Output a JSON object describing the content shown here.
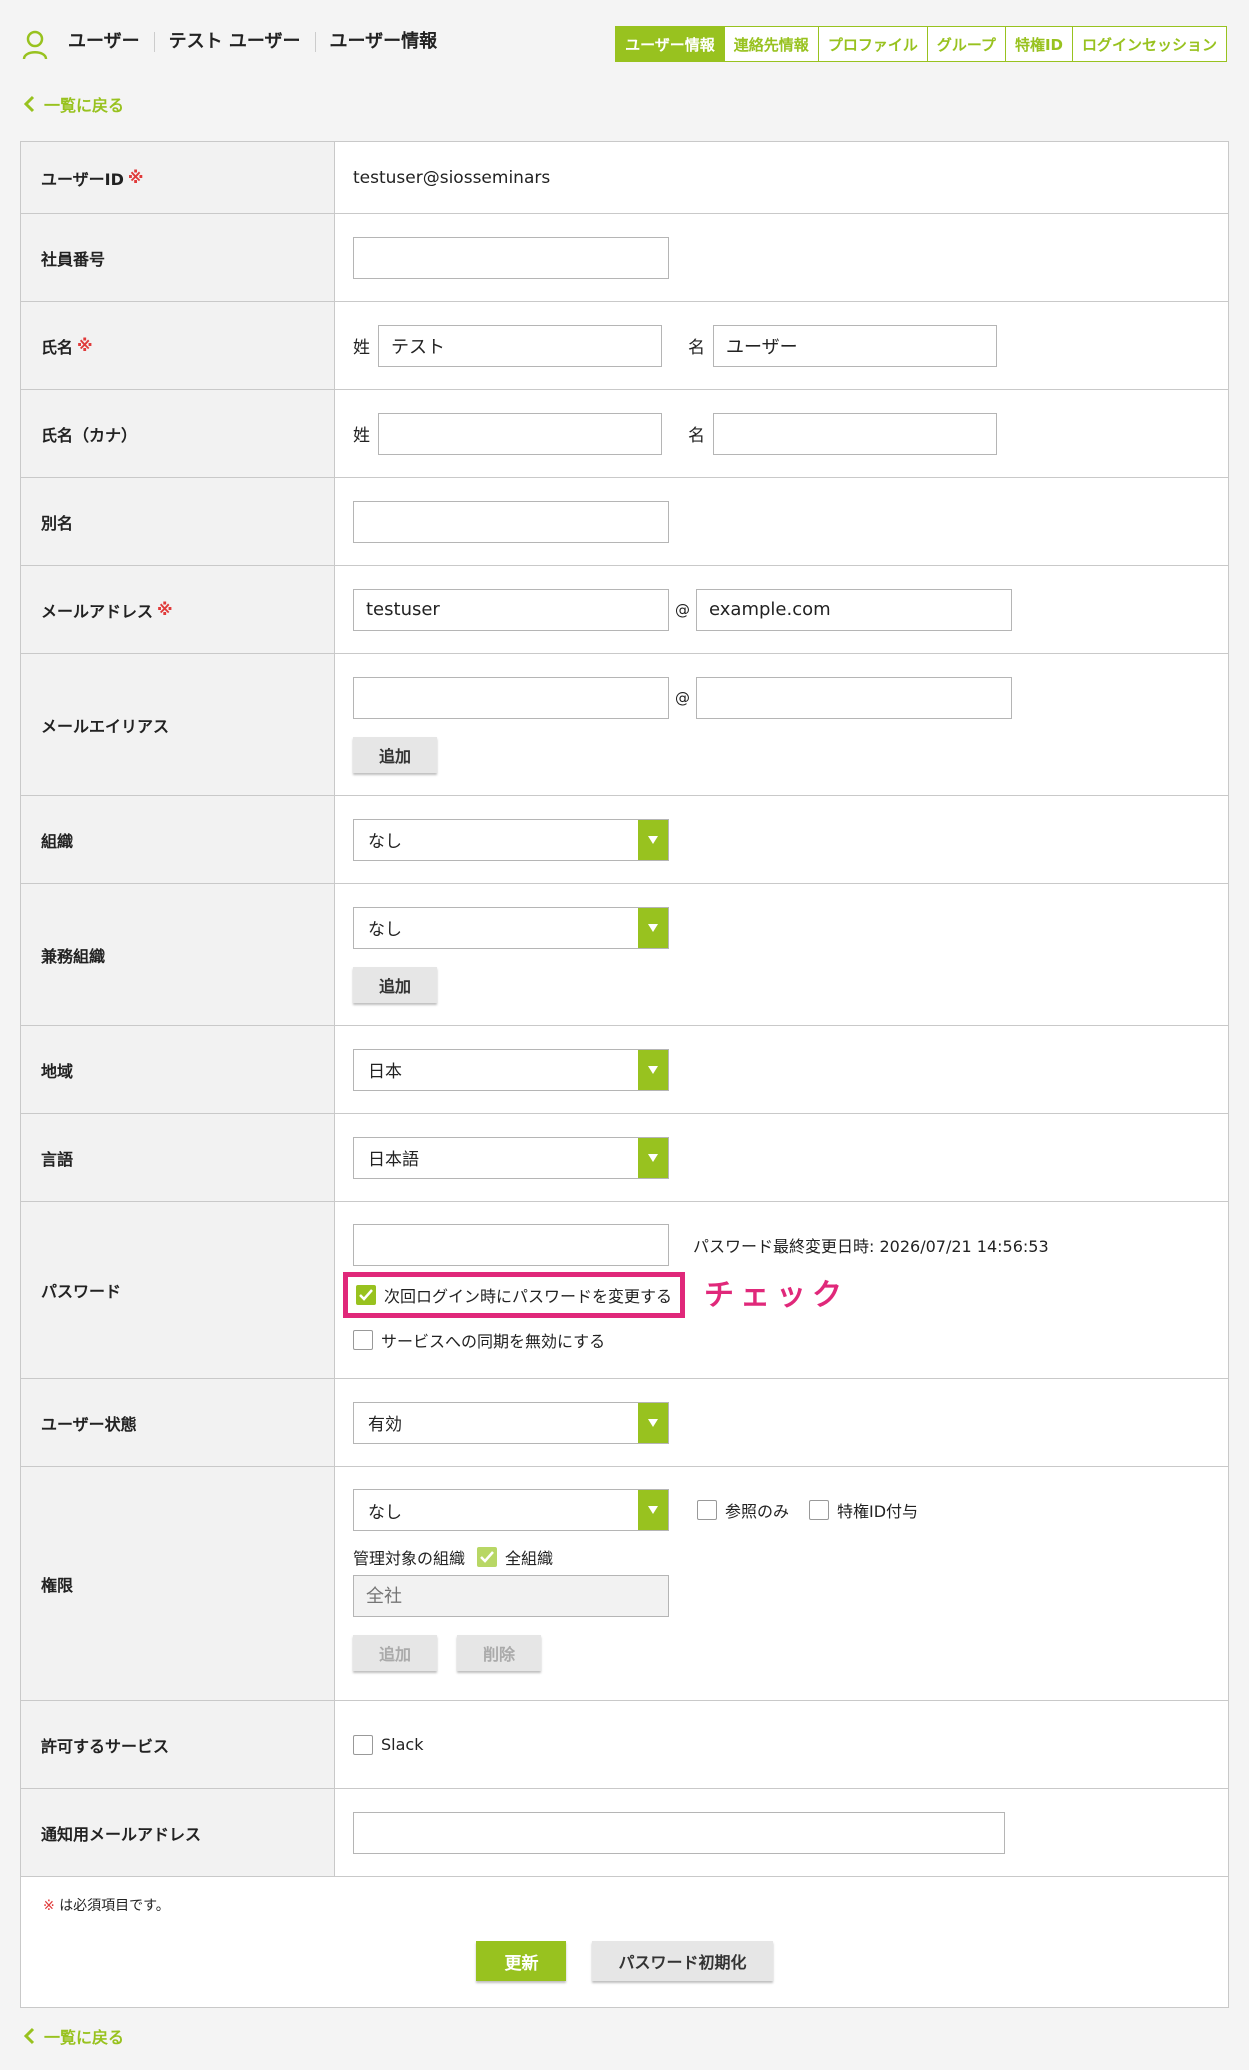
{
  "breadcrumb": [
    "ユーザー",
    "テスト ユーザー",
    "ユーザー情報"
  ],
  "tabs": [
    "ユーザー情報",
    "連絡先情報",
    "プロファイル",
    "グループ",
    "特権ID",
    "ログインセッション"
  ],
  "back_label": "一覧に戻る",
  "required_mark": "※",
  "fields": {
    "user_id": {
      "label": "ユーザーID",
      "value": "testuser@siosseminars"
    },
    "employee_no": {
      "label": "社員番号",
      "value": ""
    },
    "name": {
      "label": "氏名",
      "last_label": "姓",
      "last_value": "テスト",
      "first_label": "名",
      "first_value": "ユーザー"
    },
    "name_kana": {
      "label": "氏名（カナ）",
      "last_label": "姓",
      "last_value": "",
      "first_label": "名",
      "first_value": ""
    },
    "alias": {
      "label": "別名",
      "value": ""
    },
    "email": {
      "label": "メールアドレス",
      "local": "testuser",
      "at": "@",
      "domain": "example.com"
    },
    "email_alias": {
      "label": "メールエイリアス",
      "at": "@",
      "add_label": "追加"
    },
    "org": {
      "label": "組織",
      "value": "なし"
    },
    "sub_org": {
      "label": "兼務組織",
      "value": "なし",
      "add_label": "追加"
    },
    "region": {
      "label": "地域",
      "value": "日本"
    },
    "language": {
      "label": "言語",
      "value": "日本語"
    },
    "password": {
      "label": "パスワード",
      "last_changed": "パスワード最終変更日時: 2026/07/21 14:56:53",
      "change_next_login": "次回ログイン時にパスワードを変更する",
      "disable_sync": "サービスへの同期を無効にする"
    },
    "status": {
      "label": "ユーザー状態",
      "value": "有効"
    },
    "privilege": {
      "label": "権限",
      "value": "なし",
      "readonly_label": "参照のみ",
      "priv_id_label": "特権ID付与",
      "managed_org_label": "管理対象の組織",
      "all_org_label": "全組織",
      "org_placeholder": "全社",
      "add_label": "追加",
      "delete_label": "削除"
    },
    "services": {
      "label": "許可するサービス",
      "slack": "Slack"
    },
    "notify_email": {
      "label": "通知用メールアドレス",
      "value": ""
    }
  },
  "callout_text": "チェック",
  "footer": {
    "note": "は必須項目です。",
    "update_label": "更新",
    "reset_password_label": "パスワード初期化"
  },
  "colors": {
    "accent": "#98c21f",
    "required": "#e03a3a",
    "highlight": "#e0287a"
  }
}
